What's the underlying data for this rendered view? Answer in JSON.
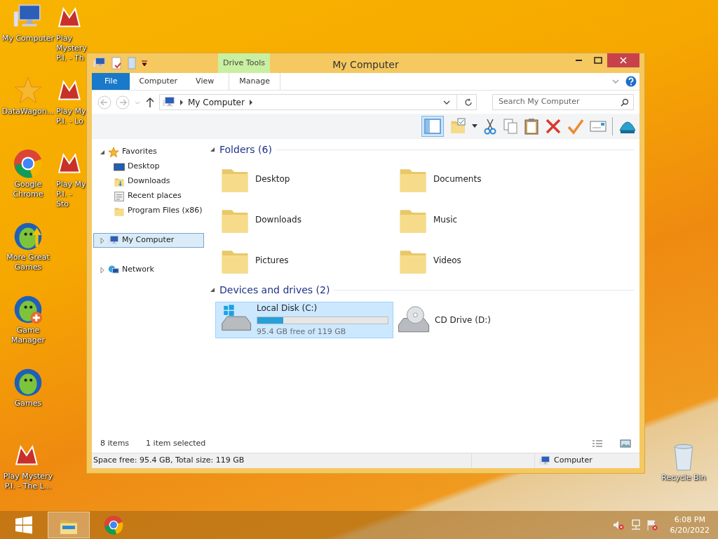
{
  "desktop_icons": [
    {
      "label": "My Computer",
      "kind": "computer"
    },
    {
      "label": "DataWagon...",
      "kind": "star"
    },
    {
      "label": "Google Chrome",
      "kind": "chrome"
    },
    {
      "label": "More Great Games",
      "kind": "fish-up"
    },
    {
      "label": "Game Manager",
      "kind": "fish-plus"
    },
    {
      "label": "Games",
      "kind": "fish"
    },
    {
      "label": "Play Mystery P.I. - The L...",
      "kind": "mpi"
    },
    {
      "label": "Play Mystery P.I. - Th",
      "kind": "mpi"
    },
    {
      "label": "Play My P.I. - Lo",
      "kind": "mpi"
    },
    {
      "label": "Play My P.I. - Sto",
      "kind": "mpi"
    },
    {
      "label": "Recycle Bin",
      "kind": "bin"
    }
  ],
  "window": {
    "title": "My Computer",
    "context_group": "Drive Tools",
    "tabs": [
      {
        "label": "File",
        "kind": "file",
        "selected": false
      },
      {
        "label": "Computer",
        "kind": "tab",
        "selected": false
      },
      {
        "label": "View",
        "kind": "tab",
        "selected": false
      },
      {
        "label": "Manage",
        "kind": "context",
        "selected": false
      }
    ],
    "address": {
      "path": "My Computer"
    },
    "search": {
      "placeholder": "Search My Computer"
    },
    "nav": [
      {
        "label": "Favorites",
        "kind": "star",
        "expanded": true,
        "selected": false,
        "children": [
          {
            "label": "Desktop",
            "kind": "desktop",
            "selected": false
          },
          {
            "label": "Downloads",
            "kind": "downloads",
            "selected": false
          },
          {
            "label": "Recent places",
            "kind": "recent",
            "selected": false
          },
          {
            "label": "Program Files (x86)",
            "kind": "folder",
            "selected": false
          }
        ]
      },
      {
        "label": "My Computer",
        "kind": "computer",
        "expanded": false,
        "selected": true
      },
      {
        "label": "Network",
        "kind": "network",
        "expanded": false,
        "selected": false
      }
    ],
    "sections": [
      {
        "title": "Folders (6)",
        "items": [
          {
            "name": "Desktop",
            "kind": "folder",
            "selected": false
          },
          {
            "name": "Documents",
            "kind": "folder",
            "selected": false
          },
          {
            "name": "Downloads",
            "kind": "folder",
            "selected": false
          },
          {
            "name": "Music",
            "kind": "folder",
            "selected": false
          },
          {
            "name": "Pictures",
            "kind": "folder",
            "selected": false
          },
          {
            "name": "Videos",
            "kind": "folder",
            "selected": false
          }
        ]
      },
      {
        "title": "Devices and drives (2)",
        "items": [
          {
            "name": "Local Disk (C:)",
            "kind": "drive",
            "selected": true,
            "level": 0.2,
            "detail": "95.4 GB free of 119 GB"
          },
          {
            "name": "CD Drive (D:)",
            "kind": "cd",
            "selected": false
          }
        ]
      }
    ],
    "status": {
      "count": "8 items",
      "selection": "1 item selected"
    },
    "details": {
      "space": "Space free: 95.4 GB, Total size: 119 GB",
      "location": "Computer"
    }
  },
  "taskbar": {
    "buttons": [
      {
        "kind": "explorer",
        "active": true
      },
      {
        "kind": "chrome",
        "active": false
      }
    ],
    "time": "6:08 PM",
    "date": "6/20/2022"
  }
}
